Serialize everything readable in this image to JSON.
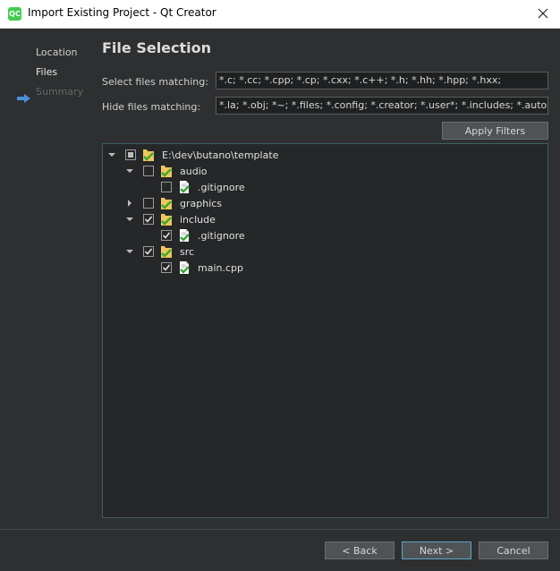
{
  "window": {
    "title": "Import Existing Project - Qt Creator",
    "app_icon_text": "QC",
    "close_icon": "close-icon"
  },
  "wizard_steps": [
    {
      "label": "Location",
      "state": "done"
    },
    {
      "label": "Files",
      "state": "current"
    },
    {
      "label": "Summary",
      "state": "pending"
    }
  ],
  "page": {
    "heading": "File Selection",
    "select_label": "Select files matching:",
    "select_value": "*.c; *.cc; *.cpp; *.cp; *.cxx; *.c++; *.h; *.hh; *.hpp; *.hxx;",
    "hide_label": "Hide files matching:",
    "hide_value": "*.la; *.obj; *~; *.files; *.config; *.creator; *.user*; *.includes; *.autosave",
    "apply_filters_label": "Apply Filters"
  },
  "tree": [
    {
      "label": "E:\\dev\\butano\\template",
      "kind": "folder",
      "check": "partial",
      "expanded": true
    },
    {
      "label": "audio",
      "kind": "folder",
      "check": "unchecked",
      "expanded": true
    },
    {
      "label": ".gitignore",
      "kind": "file",
      "check": "unchecked"
    },
    {
      "label": "graphics",
      "kind": "folder",
      "check": "unchecked",
      "expanded": false
    },
    {
      "label": "include",
      "kind": "folder",
      "check": "checked",
      "expanded": true
    },
    {
      "label": ".gitignore",
      "kind": "file",
      "check": "checked"
    },
    {
      "label": "src",
      "kind": "folder",
      "check": "checked",
      "expanded": true
    },
    {
      "label": "main.cpp",
      "kind": "file",
      "check": "checked"
    }
  ],
  "buttons": {
    "back": "< Back",
    "next": "Next >",
    "cancel": "Cancel"
  },
  "colors": {
    "accent_arrow": "#4a90d9",
    "folder_yellow": "#f0c75a",
    "check_green": "#3aa83a"
  }
}
